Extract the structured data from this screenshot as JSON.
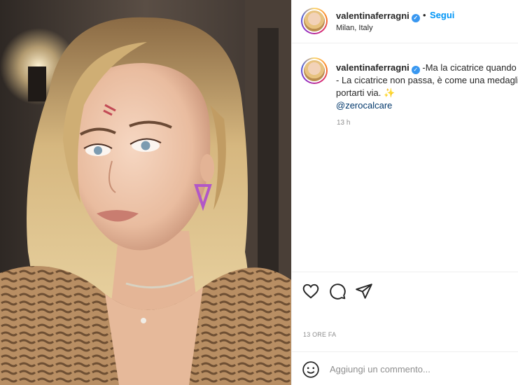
{
  "post": {
    "image_alt": "Selfie of a blonde woman with a small red mark on her forehead",
    "image_icon": "photo"
  },
  "header": {
    "username": "valentinaferragni",
    "separator": "•",
    "follow_label": "Segui",
    "location": "Milan, Italy",
    "verified_icon": "verified-badge"
  },
  "caption": {
    "username": "valentinaferragni",
    "line1": "-Ma la cicatrice quando",
    "line2": "- La cicatrice non passa, è come una medagli",
    "line3": "portarti via.",
    "emoji": "✨",
    "mention": "@zerocalcare",
    "time": "13 h"
  },
  "actions": {
    "like_icon": "heart",
    "comment_icon": "speech-bubble",
    "share_icon": "paper-plane"
  },
  "timestamp": "13 ORE FA",
  "comment": {
    "placeholder": "Aggiungi un commento...",
    "emoji_icon": "smiley"
  },
  "colors": {
    "accent": "#0095f6",
    "verified": "#3897f0",
    "muted": "#8e8e8e",
    "divider": "#efefef"
  }
}
